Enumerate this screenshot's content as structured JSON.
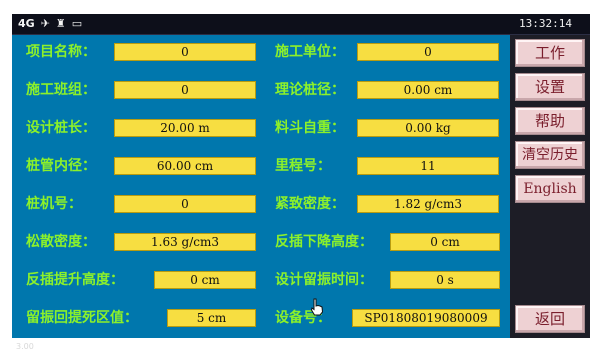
{
  "status": {
    "icons": [
      {
        "name": "4g-icon",
        "glyph": "4G"
      },
      {
        "name": "satellite-icon",
        "glyph": "✈"
      },
      {
        "name": "antenna-icon",
        "glyph": "♜"
      },
      {
        "name": "battery-icon",
        "glyph": "▭"
      }
    ],
    "time": "13:32:14"
  },
  "fields": [
    {
      "label": "项目名称：",
      "value": "0"
    },
    {
      "label": "施工单位：",
      "value": "0"
    },
    {
      "label": "施工班组：",
      "value": "0"
    },
    {
      "label": "理论桩径：",
      "value": "0.00 cm"
    },
    {
      "label": "设计桩长：",
      "value": "20.00 m"
    },
    {
      "label": "料斗自重：",
      "value": "0.00 kg"
    },
    {
      "label": "桩管内径：",
      "value": "60.00 cm"
    },
    {
      "label": "里程号：",
      "value": "11"
    },
    {
      "label": "桩机号：",
      "value": "0"
    },
    {
      "label": "紧致密度：",
      "value": "1.82 g/cm3"
    },
    {
      "label": "松散密度：",
      "value": "1.63 g/cm3"
    },
    {
      "label": "反插下降高度：",
      "value": "0 cm"
    },
    {
      "label": "反插提升高度：",
      "value": "0 cm"
    },
    {
      "label": "设计留振时间：",
      "value": "0 s"
    },
    {
      "label": "留振回提死区值：",
      "value": "5 cm"
    },
    {
      "label": "设备号：",
      "value": "SP01808019080009"
    }
  ],
  "version": "3.00",
  "sidebar": {
    "work": "工作",
    "settings": "设置",
    "help": "帮助",
    "clear_history": "清空历史",
    "english": "English",
    "back": "返回"
  },
  "colors": {
    "panel": "#0077ad",
    "label": "#8cf12a",
    "field": "#f7de41",
    "button": "#eed1d3",
    "button_text": "#7a1e2c"
  }
}
